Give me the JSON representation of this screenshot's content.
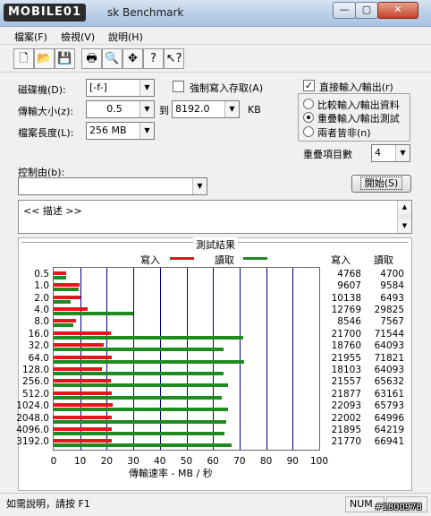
{
  "window": {
    "logo_text": "MOBILE01",
    "title": "sk Benchmark",
    "min_glyph": "—",
    "max_glyph": "▢",
    "close_glyph": "✕"
  },
  "menu": [
    {
      "label": "檔案(F)"
    },
    {
      "label": "檢視(V)"
    },
    {
      "label": "說明(H)"
    }
  ],
  "toolbar": {
    "icons": [
      "new-icon",
      "open-icon",
      "save-icon",
      "print-icon",
      "print-preview-icon",
      "move-icon",
      "help-icon",
      "context-help-icon"
    ],
    "glyphs": [
      "🗋",
      "📂",
      "💾",
      "🖶",
      "🔍",
      "✥",
      "?",
      "↖?"
    ]
  },
  "settings": {
    "drive_label": "磁碟機(D):",
    "drive_value": "[-f-]",
    "force_write_label": "強制寫入存取(A)",
    "force_write_checked": false,
    "direct_io_label": "直接輸入/輸出(r)",
    "direct_io_checked": true,
    "transfer_size_label": "傳輸大小(z):",
    "transfer_from": "0.5",
    "to_label": "到",
    "transfer_to": "8192.0",
    "kb_label": "KB",
    "file_length_label": "檔案長度(L):",
    "file_length_value": "256 MB",
    "mode_options": [
      {
        "label": "比較輸入/輸出資料",
        "selected": false
      },
      {
        "label": "重疊輸入/輸出測試",
        "selected": true
      },
      {
        "label": "兩者皆非(n)",
        "selected": false
      }
    ],
    "queue_depth_label": "重疊項目數",
    "queue_depth_value": "4",
    "controlled_by_label": "控制由(b):",
    "controlled_by_value": "",
    "start_label": "開始(S)",
    "description_text": "<<   描述   >>"
  },
  "results": {
    "title": "測試結果",
    "write_legend": "寫入",
    "read_legend": "讀取",
    "write_header": "寫入",
    "read_header": "讀取",
    "x_axis_label": "傳輸速率 - MB / 秒"
  },
  "chart_data": {
    "type": "bar",
    "orientation": "horizontal",
    "title": "測試結果",
    "xlabel": "傳輸速率 - MB / 秒",
    "ylabel": "",
    "xlim": [
      0,
      100
    ],
    "x_ticks": [
      "0",
      "10",
      "20",
      "30",
      "40",
      "50",
      "60",
      "70",
      "80",
      "90",
      "100"
    ],
    "categories": [
      "0.5",
      "1.0",
      "2.0",
      "4.0",
      "8.0",
      "16.0",
      "32.0",
      "64.0",
      "128.0",
      "256.0",
      "512.0",
      "1024.0",
      "2048.0",
      "4096.0",
      "3192.0"
    ],
    "series": [
      {
        "name": "寫入",
        "color": "#e8141c",
        "values": [
          4768,
          9607,
          10138,
          12769,
          8546,
          21700,
          18760,
          21955,
          18103,
          21557,
          21877,
          22093,
          22002,
          21895,
          21770
        ]
      },
      {
        "name": "讀取",
        "color": "#1f8a1f",
        "values": [
          4700,
          9584,
          6493,
          29825,
          7567,
          71544,
          64093,
          71821,
          64093,
          65632,
          63161,
          65793,
          64996,
          64219,
          66941
        ]
      }
    ],
    "value_unit_note": "KB/s shown in columns; bars in MB/s"
  },
  "statusbar": {
    "help_text": "如需說明，請按 F1",
    "num_indicator": "NUM",
    "watermark": "#1800978"
  }
}
